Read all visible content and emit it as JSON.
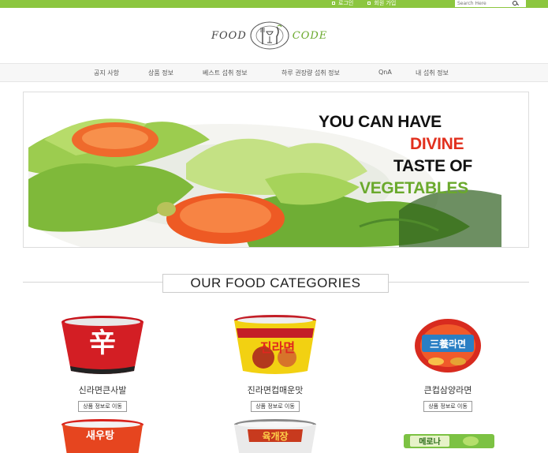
{
  "topbar": {
    "login": "로그인",
    "signup": "회원 가입",
    "search_placeholder": "Search Here"
  },
  "logo": {
    "word1": "FOOD",
    "word2": "CODE"
  },
  "nav": [
    "공지 사항",
    "상품 정보",
    "베스트 섭취 정보",
    "하루 권장량 섭취 정보",
    "QnA",
    "내 섭취 정보"
  ],
  "banner": {
    "line1": "YOU CAN HAVE",
    "line2": "DIVINE",
    "line3": "TASTE OF",
    "line4": "VEGETABLES"
  },
  "section_title": "OUR FOOD CATEGORIES",
  "products": [
    {
      "name": "신라면큰사발",
      "button": "상품 정보로 이동",
      "label": "辛"
    },
    {
      "name": "진라면컵매운맛",
      "button": "상품 정보로 이동",
      "label": "진라면"
    },
    {
      "name": "큰컵삼양라면",
      "button": "상품 정보로 이동",
      "label": "三養라면"
    }
  ],
  "products_row2_labels": [
    "새우탕",
    "육개장",
    "메로나"
  ],
  "colors": {
    "brand_green": "#8cc63f",
    "accent_red": "#e1301e",
    "veg_green": "#6aa92c"
  }
}
